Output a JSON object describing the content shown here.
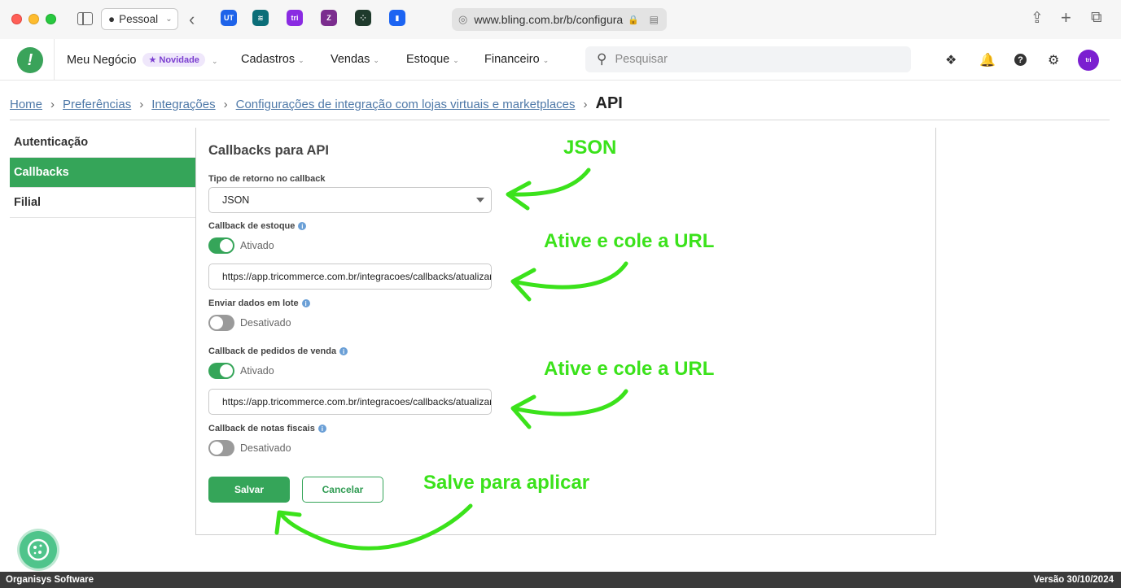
{
  "browser": {
    "profile_label": "Pessoal",
    "url": "www.bling.com.br/b/configura",
    "tabs": [
      {
        "icon": "ut-tab-icon",
        "label": "UT",
        "color": "#1e63e9"
      },
      {
        "icon": "layers-tab-icon",
        "label": "≋",
        "color": "#0b6e78"
      },
      {
        "icon": "tri-tab-icon",
        "label": "tri",
        "color": "#8a2be2"
      },
      {
        "icon": "slash-tab-icon",
        "label": "Z",
        "color": "#7b2d8e"
      },
      {
        "icon": "grid-tab-icon",
        "label": "⁘",
        "color": "#1f3a2c"
      },
      {
        "icon": "trello-tab-icon",
        "label": "▮",
        "color": "#1c64f2"
      }
    ]
  },
  "header": {
    "logo_char": "!",
    "nav": [
      {
        "label": "Meu Negócio",
        "badge": "Novidade"
      },
      {
        "label": "Cadastros"
      },
      {
        "label": "Vendas"
      },
      {
        "label": "Estoque"
      },
      {
        "label": "Financeiro"
      }
    ],
    "search_placeholder": "Pesquisar",
    "avatar_text": "tri"
  },
  "breadcrumb": {
    "items": [
      "Home",
      "Preferências",
      "Integrações",
      "Configurações de integração com lojas virtuais e marketplaces"
    ],
    "current": "API"
  },
  "side_menu": {
    "items": [
      {
        "label": "Autenticação",
        "active": false
      },
      {
        "label": "Callbacks",
        "active": true
      },
      {
        "label": "Filial",
        "active": false
      }
    ]
  },
  "form": {
    "title": "Callbacks para API",
    "return_type_label": "Tipo de retorno no callback",
    "return_type_value": "JSON",
    "stock_label": "Callback de estoque",
    "stock_status": "Ativado",
    "stock_url": "https://app.tricommerce.com.br/integracoes/callbacks/atualizar",
    "batch_label": "Enviar dados em lote",
    "batch_status": "Desativado",
    "orders_label": "Callback de pedidos de venda",
    "orders_status": "Ativado",
    "orders_url": "https://app.tricommerce.com.br/integracoes/callbacks/atualizar",
    "invoices_label": "Callback de notas fiscais",
    "invoices_status": "Desativado",
    "save_label": "Salvar",
    "cancel_label": "Cancelar"
  },
  "annotations": {
    "json": "JSON",
    "paste_url_1": "Ative e cole a URL",
    "paste_url_2": "Ative e cole a URL",
    "save": "Salve para aplicar",
    "color": "#3be21b"
  },
  "footer": {
    "company": "Organisys Software",
    "version": "Versão 30/10/2024"
  }
}
